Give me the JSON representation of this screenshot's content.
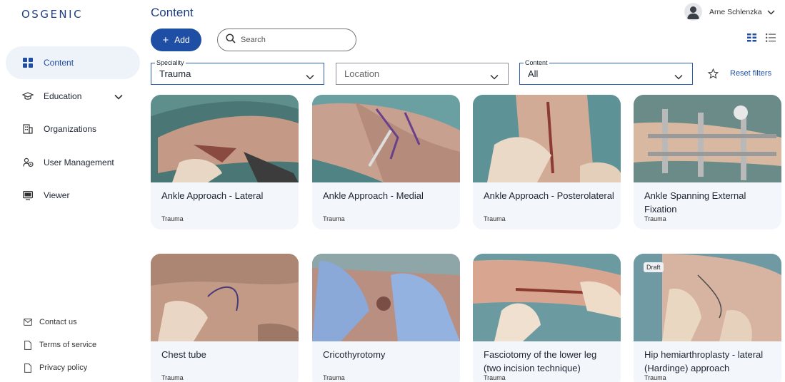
{
  "app": {
    "logo": "OSGENIC",
    "page_title": "Content"
  },
  "user": {
    "name": "Arne Schlenzka"
  },
  "toolbar": {
    "add_label": "Add",
    "search_placeholder": "Search"
  },
  "sidebar": {
    "items": [
      {
        "label": "Content",
        "icon": "grid-icon",
        "active": true
      },
      {
        "label": "Education",
        "icon": "graduation-cap-icon"
      },
      {
        "label": "Organizations",
        "icon": "building-icon"
      },
      {
        "label": "User Management",
        "icon": "users-icon"
      },
      {
        "label": "Viewer",
        "icon": "monitor-icon"
      }
    ],
    "footer": [
      {
        "label": "Contact us",
        "icon": "mail-icon"
      },
      {
        "label": "Terms of service",
        "icon": "document-icon"
      },
      {
        "label": "Privacy policy",
        "icon": "document-icon"
      }
    ]
  },
  "filters": {
    "speciality": {
      "legend": "Speciality",
      "value": "Trauma"
    },
    "location": {
      "placeholder": "Location"
    },
    "content": {
      "legend": "Content",
      "value": "All"
    },
    "reset_label": "Reset filters"
  },
  "cards": [
    {
      "title": "Ankle Approach - Lateral",
      "category": "Trauma"
    },
    {
      "title": "Ankle Approach - Medial",
      "category": "Trauma"
    },
    {
      "title": "Ankle Approach - Posterolateral",
      "category": "Trauma"
    },
    {
      "title": "Ankle Spanning External Fixation",
      "category": "Trauma"
    },
    {
      "title": "Chest tube",
      "category": "Trauma"
    },
    {
      "title": "Cricothyrotomy",
      "category": "Trauma"
    },
    {
      "title": "Fasciotomy of the lower leg (two incision technique)",
      "category": "Trauma"
    },
    {
      "title": "Hip hemiarthroplasty - lateral (Hardinge) approach",
      "category": "Trauma",
      "badge": "Draft"
    }
  ],
  "colors": {
    "brand": "#1f3f86",
    "accent": "#1f4ea5",
    "card_bg": "#f3f6fa",
    "active_nav_bg": "#eef2f9"
  }
}
